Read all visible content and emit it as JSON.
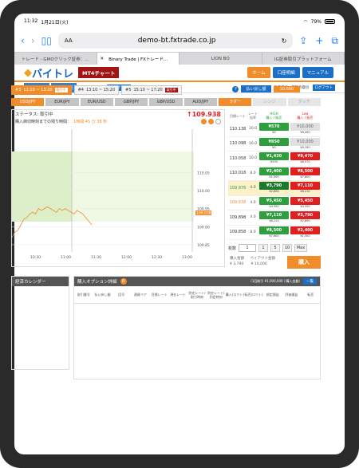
{
  "status_bar": {
    "time": "11:32",
    "date": "1月21日(火)",
    "battery": "79%"
  },
  "browser": {
    "aa": "AA",
    "url": "demo-bt.fxtrade.co.jp",
    "tabs": [
      {
        "label": "トレード - GMOクリック証券：…",
        "active": false
      },
      {
        "label": "Binary Trade | FXトレード…",
        "active": true
      },
      {
        "label": "LION BO",
        "active": false
      },
      {
        "label": "IG証券取引プラットフォーム",
        "active": false
      }
    ]
  },
  "site": {
    "logo": "バイトレ",
    "logo_sub": "BINARY TRADE",
    "mt4_label": "MT4チャート",
    "header_buttons": [
      "ホーム",
      "口座明細",
      "マニュアル"
    ],
    "subtabs": [
      "会員情報",
      "取引情報"
    ],
    "login_label": "ユーザー名",
    "account_label": "口座番号",
    "last_login": "前回の取引",
    "logout": "ログアウト"
  },
  "options": [
    {
      "num": "#3",
      "time": "11:10 ~ 13:20",
      "badge": "取引中",
      "active": true
    },
    {
      "num": "#4",
      "time": "13:10 ~ 15:20",
      "badge": "",
      "active": false
    },
    {
      "num": "#5",
      "time": "15:10 ~ 17:20",
      "badge": "取引中",
      "active": false
    }
  ],
  "payback": {
    "label": "払い戻し額",
    "value": "10,000"
  },
  "pairs": [
    {
      "label": "USD/JPY",
      "state": "active"
    },
    {
      "label": "EUR/JPY",
      "state": "normal"
    },
    {
      "label": "EUR/USD",
      "state": "normal"
    },
    {
      "label": "GBP/JPY",
      "state": "normal"
    },
    {
      "label": "GBP/USD",
      "state": "normal"
    },
    {
      "label": "AUD/JPY",
      "state": "normal"
    },
    {
      "label": "ラダー",
      "state": "active"
    },
    {
      "label": "レンジ",
      "state": "dim"
    },
    {
      "label": "タッチ",
      "state": "dim"
    }
  ],
  "chart_panel": {
    "status": "ステータス: 取引中",
    "price": "109.938",
    "remain_label": "購入締切時刻までの残り時間：",
    "remain_value": "1時間 45 分 38 秒"
  },
  "chart_data": {
    "type": "line",
    "x_ticks": [
      "10:30",
      "11:00",
      "11:30",
      "12:00",
      "12:30",
      "13:00"
    ],
    "y_ticks": [
      "110.05",
      "110.00",
      "109.95",
      "109.90",
      "109.85"
    ],
    "ylim": [
      109.83,
      110.17
    ],
    "series": [
      {
        "values": [
          109.87,
          109.885,
          109.89,
          109.905,
          109.92,
          109.925,
          109.935,
          109.94,
          109.935,
          109.95,
          109.945,
          109.95,
          109.955,
          109.95,
          109.945,
          109.94,
          109.95,
          109.945,
          109.95,
          109.945,
          109.94,
          109.935,
          109.945,
          109.94,
          109.935,
          109.925,
          109.915,
          109.905
        ]
      }
    ],
    "x_range": [
      10.0,
      11.55
    ],
    "current_price": "109.938",
    "rate_labels": [
      "110.138",
      "110.098",
      "110.058",
      "110.018",
      "109.976",
      "109.938",
      "109.898",
      "109.858"
    ]
  },
  "rate_table": {
    "head_target": "目標レート",
    "head_odds": "レート倍率",
    "head_high": "HIGH",
    "head_high_sub": "購入 / 販売",
    "head_low": "Low",
    "head_low_sub": "購入 / 販売",
    "rows": [
      {
        "price": "110.138",
        "odds": "20.0",
        "high": "¥570",
        "high_sub": "¥0",
        "low": "¥10,000",
        "low_sub": "¥9,450",
        "high_style": "g",
        "low_style": "gray",
        "price_style": "",
        "hl": false
      },
      {
        "price": "110.098",
        "odds": "16.0",
        "high": "¥850",
        "high_sub": "¥0",
        "low": "¥10,000",
        "low_sub": "¥9,150",
        "high_style": "g",
        "low_style": "gray",
        "price_style": "",
        "hl": false
      },
      {
        "price": "110.058",
        "odds": "10.0",
        "high": "¥1,430",
        "high_sub": "¥530",
        "low": "¥9,470",
        "low_sub": "¥8,570",
        "high_style": "g",
        "low_style": "r",
        "price_style": "",
        "hl": false
      },
      {
        "price": "110.018",
        "odds": "8.0",
        "high": "¥2,400",
        "high_sub": "¥1,500",
        "low": "¥8,500",
        "low_sub": "¥7,600",
        "high_style": "g",
        "low_style": "r",
        "price_style": "",
        "hl": false
      },
      {
        "price": "109.976",
        "odds": "4.0",
        "high": "¥3,790",
        "high_sub": "¥2,890",
        "low": "¥7,110",
        "low_sub": "¥6,210",
        "high_style": "g dark",
        "low_style": "r",
        "price_style": "green",
        "hl": true
      },
      {
        "price": "109.938",
        "odds": "4.0",
        "high": "¥5,450",
        "high_sub": "¥4,550",
        "low": "¥5,450",
        "low_sub": "¥4,550",
        "high_style": "g",
        "low_style": "r",
        "price_style": "orange",
        "hl": false
      },
      {
        "price": "109.898",
        "odds": "4.0",
        "high": "¥7,110",
        "high_sub": "¥6,210",
        "low": "¥3,790",
        "low_sub": "¥2,890",
        "high_style": "g",
        "low_style": "r",
        "price_style": "",
        "hl": false
      },
      {
        "price": "109.858",
        "odds": "8.0",
        "high": "¥8,500",
        "high_sub": "¥7,600",
        "low": "¥2,400",
        "low_sub": "¥1,500",
        "high_style": "g",
        "low_style": "r",
        "price_style": "",
        "hl": false
      }
    ]
  },
  "quantity": {
    "label": "枚数",
    "value": "1",
    "choices": [
      "1",
      "5",
      "10",
      "Max"
    ]
  },
  "purchase": {
    "price_label": "購入金額",
    "price": "¥ 3,790",
    "payout_label": "ペイアウト金額",
    "payout": "¥ 10,000",
    "buy": "購入"
  },
  "calendar": {
    "title": "経済カレンダー"
  },
  "detail": {
    "title": "購入オプション詳細",
    "count": "0",
    "limit": "(1回取引 ¥1,000,000 / 購入金額)",
    "list_btn": "一覧",
    "columns": [
      "取引番号",
      "払い戻し額",
      "回号",
      "通貨ペア",
      "目標レート",
      "現在レート",
      "判定レート/取引時刻",
      "判定レート/判定時刻",
      "購入(ロウト)",
      "転売(ロウト)",
      "想定損益",
      "評価損益",
      "転売"
    ]
  }
}
